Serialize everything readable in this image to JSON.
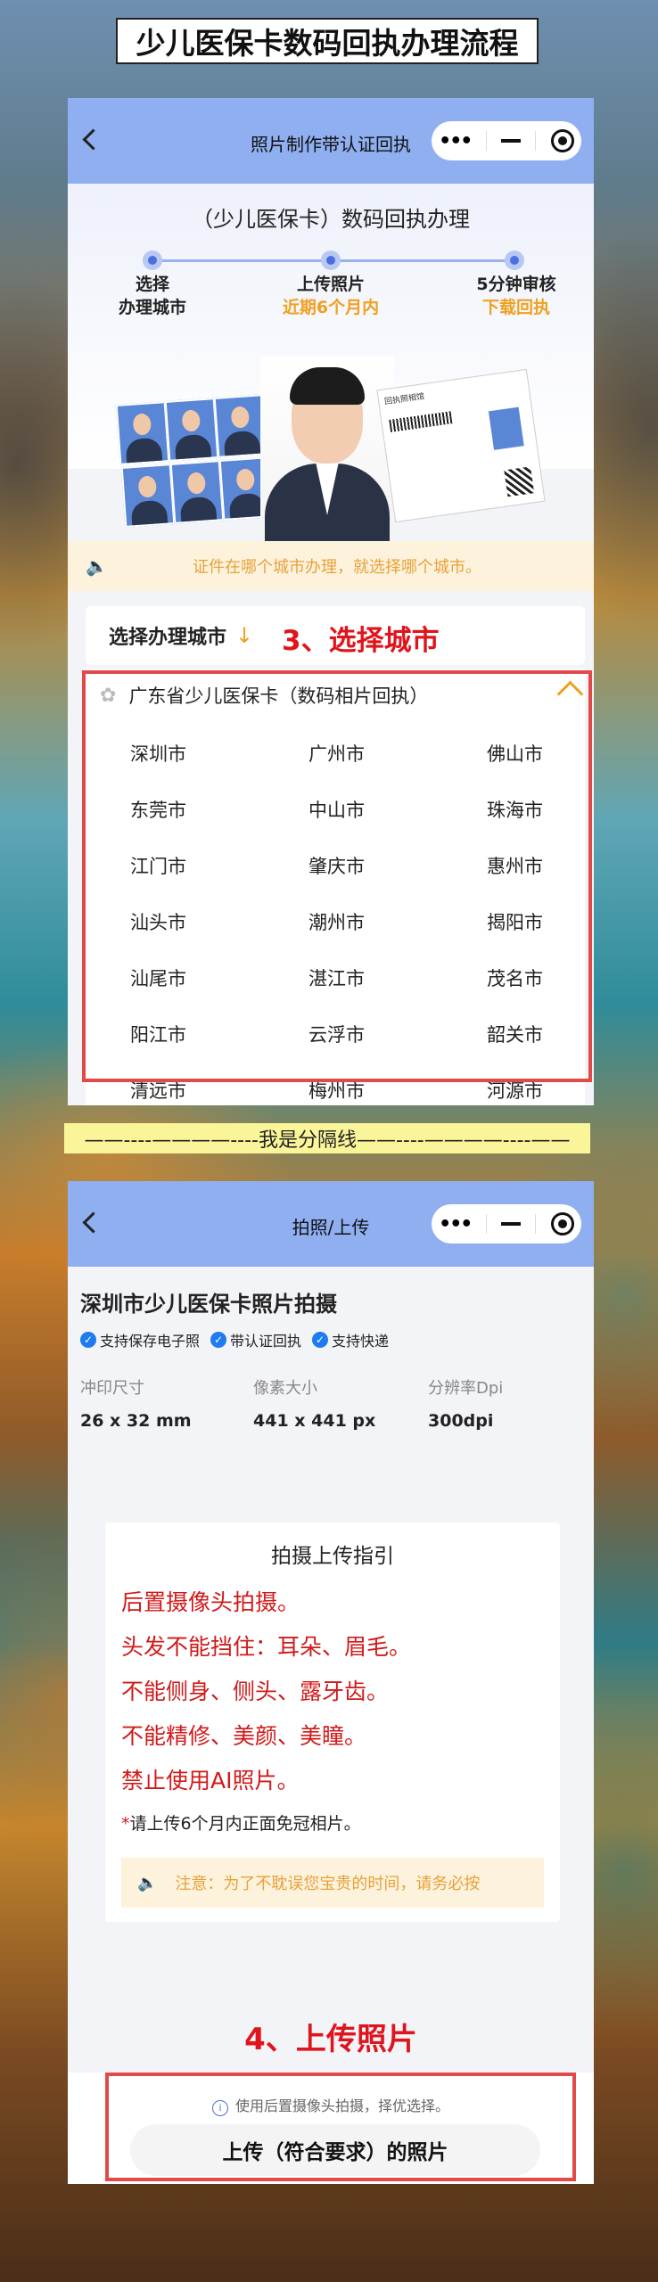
{
  "page_title": "少儿医保卡数码回执办理流程",
  "phone1": {
    "nav_title": "照片制作带认证回执",
    "capsule": {
      "more": "•••",
      "minimize": "minimize-icon",
      "close": "target-icon"
    },
    "steps_heading": "（少儿医保卡）数码回执办理",
    "steps": [
      {
        "line1": "选择",
        "line2": "办理城市"
      },
      {
        "line1": "上传照片",
        "line2": "近期6个月内"
      },
      {
        "line1": "5分钟审核",
        "line2": "下载回执"
      }
    ],
    "receipt_header": "回执照相馆",
    "notice": "证件在哪个城市办理，就选择哪个城市。",
    "select_city_label": "选择办理城市",
    "select_city_arrow": "↓",
    "annotation_step3": "3、选择城市",
    "province": "广东省少儿医保卡（数码相片回执）",
    "cities": [
      [
        "深圳市",
        "广州市",
        "佛山市"
      ],
      [
        "东莞市",
        "中山市",
        "珠海市"
      ],
      [
        "江门市",
        "肇庆市",
        "惠州市"
      ],
      [
        "汕头市",
        "潮州市",
        "揭阳市"
      ],
      [
        "汕尾市",
        "湛江市",
        "茂名市"
      ],
      [
        "阳江市",
        "云浮市",
        "韶关市"
      ],
      [
        "清远市",
        "梅州市",
        "河源市"
      ]
    ]
  },
  "divider_text": "——----————----我是分隔线——----————----——",
  "phone2": {
    "nav_title": "拍照/上传",
    "title": "深圳市少儿医保卡照片拍摄",
    "badges": [
      "支持保存电子照",
      "带认证回执",
      "支持快递"
    ],
    "specs": [
      {
        "key": "冲印尺寸",
        "value": "26 x 32 mm"
      },
      {
        "key": "像素大小",
        "value": "441 x 441 px"
      },
      {
        "key": "分辨率Dpi",
        "value": "300dpi"
      }
    ],
    "guide_heading": "拍摄上传指引",
    "guide_lines": [
      "后置摄像头拍摄。",
      "头发不能挡住：耳朵、眉毛。",
      "不能侧身、侧头、露牙齿。",
      "不能精修、美颜、美瞳。",
      "禁止使用AI照片。"
    ],
    "guide_star": "*",
    "guide_sub": "请上传6个月内正面免冠相片。",
    "guide_notice": "注意：为了不耽误您宝贵的时间，请务必按",
    "annotation_step4": "4、上传照片",
    "upload_tip": "使用后置摄像头拍摄，择优选择。",
    "upload_button": "上传（符合要求）的照片"
  },
  "colors": {
    "accent_blue": "#8faff1",
    "annotation_red": "#e0141c",
    "warning_orange": "#e8a23a",
    "highlight_yellow": "#fbf59a"
  }
}
